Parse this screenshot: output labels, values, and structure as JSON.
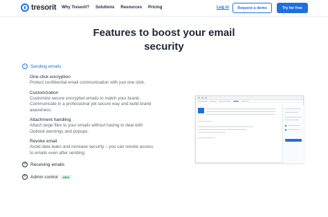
{
  "header": {
    "logo_text": "tresorit",
    "nav": [
      "Why Tresorit?",
      "Solutions",
      "Resources",
      "Pricing"
    ],
    "login": "Log in",
    "demo": "Request a demo",
    "try": "Try for free"
  },
  "title_line1": "Features to boost your email",
  "title_line2": "security",
  "features": {
    "sending": {
      "label": "Sending emails",
      "icon": "minus-circle-icon",
      "items": [
        {
          "title": "One-click encryption",
          "lines": [
            "Protect confidential email communication with just one click."
          ]
        },
        {
          "title": "Customization",
          "lines": [
            "Customize secure encrypted emails to match your brand.",
            "Communicate in a professional yet secure way and build brand",
            "awareness."
          ]
        },
        {
          "title": "Attachment handling",
          "lines": [
            "Attach large files to your emails without having to deal with",
            "Outlook warnings and popups."
          ]
        },
        {
          "title": "Revoke email",
          "lines": [
            "Avoid data leaks and increase security – you can revoke access",
            "to emails even after sending."
          ]
        }
      ]
    },
    "receiving": {
      "label": "Receiving emails",
      "icon": "plus-circle-icon"
    },
    "admin": {
      "label": "Admin control",
      "icon": "plus-circle-icon",
      "badge": "NEW"
    }
  },
  "colors": {
    "accent": "#1f6fe0",
    "text": "#1c2733",
    "muted": "#5d6773",
    "badge_bg": "#d9f7e3",
    "badge_text": "#1a8a47"
  }
}
